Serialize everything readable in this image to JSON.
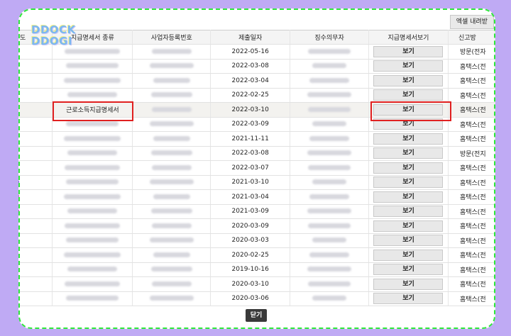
{
  "toolbar": {
    "excel_download_label": "엑셀 내려받"
  },
  "watermark": {
    "line1": "DDOCK",
    "line2": "DDOGI"
  },
  "table": {
    "headers": [
      "도",
      "지급명세서 종류",
      "사업자등록번호",
      "제출일자",
      "징수의무자",
      "지급명세서보기",
      "신고방"
    ],
    "rows": [
      {
        "doc_type": "",
        "date": "2022-05-16",
        "view": "보기",
        "method": "방문(전자"
      },
      {
        "doc_type": "",
        "date": "2022-03-08",
        "view": "보기",
        "method": "홈택스(전"
      },
      {
        "doc_type": "",
        "date": "2022-03-04",
        "view": "보기",
        "method": "홈택스(전"
      },
      {
        "doc_type": "",
        "date": "2022-02-25",
        "view": "보기",
        "method": "홈택스(전"
      },
      {
        "doc_type": "근로소득지급명세서",
        "date": "2022-03-10",
        "view": "보기",
        "method": "홈택스(전"
      },
      {
        "doc_type": "",
        "date": "2022-03-09",
        "view": "보기",
        "method": "홈택스(전"
      },
      {
        "doc_type": "",
        "date": "2021-11-11",
        "view": "보기",
        "method": "홈택스(전"
      },
      {
        "doc_type": "",
        "date": "2022-03-08",
        "view": "보기",
        "method": "방문(전지"
      },
      {
        "doc_type": "",
        "date": "2022-03-07",
        "view": "보기",
        "method": "홈택스(전"
      },
      {
        "doc_type": "",
        "date": "2021-03-10",
        "view": "보기",
        "method": "홈택스(전"
      },
      {
        "doc_type": "",
        "date": "2021-03-04",
        "view": "보기",
        "method": "홈택스(전"
      },
      {
        "doc_type": "",
        "date": "2021-03-09",
        "view": "보기",
        "method": "홈택스(전"
      },
      {
        "doc_type": "",
        "date": "2020-03-09",
        "view": "보기",
        "method": "홈택스(전"
      },
      {
        "doc_type": "",
        "date": "2020-03-03",
        "view": "보기",
        "method": "홈택스(전"
      },
      {
        "doc_type": "",
        "date": "2020-02-25",
        "view": "보기",
        "method": "홈택스(전"
      },
      {
        "doc_type": "",
        "date": "2019-10-16",
        "view": "보기",
        "method": "홈택스(전"
      },
      {
        "doc_type": "",
        "date": "2020-03-10",
        "view": "보기",
        "method": "홈택스(전"
      },
      {
        "doc_type": "",
        "date": "2020-03-06",
        "view": "보기",
        "method": "홈택스(전"
      }
    ]
  },
  "footer": {
    "close_label": "닫기"
  },
  "colors": {
    "background": "#bfaaf4",
    "dash_border": "#2ee83a",
    "highlight": "#e02020"
  }
}
